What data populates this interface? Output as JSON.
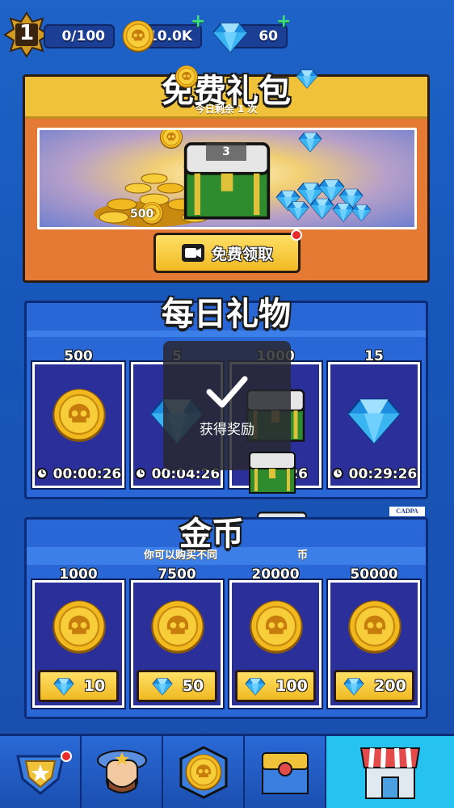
{
  "topbar": {
    "level": "1",
    "xp": "0/100",
    "coins": "10.0K",
    "gems": "60",
    "add_label": "+"
  },
  "free_gift": {
    "title": "免费礼包",
    "subtitle": "今日剩余 1 次",
    "chest_count": "3",
    "coin_amount": "500",
    "claim_label": "免费领取"
  },
  "daily_gifts": {
    "title": "每日礼物",
    "items": [
      {
        "amount": "500",
        "icon": "skull-coin-icon",
        "timer": "00:00:26"
      },
      {
        "amount": "5",
        "icon": "diamond-icon",
        "timer": "00:04:26"
      },
      {
        "amount": "1000",
        "icon": "chest-icon",
        "timer": "26"
      },
      {
        "amount": "15",
        "icon": "diamond-icon",
        "timer": "00:29:26"
      }
    ]
  },
  "toast": {
    "message": "获得奖励"
  },
  "coin_shop": {
    "title": "金币",
    "subtitle": "你可以购买不同",
    "subtitle_tail": "币",
    "items": [
      {
        "amount": "1000",
        "price": "10"
      },
      {
        "amount": "7500",
        "price": "50"
      },
      {
        "amount": "20000",
        "price": "100"
      },
      {
        "amount": "50000",
        "price": "200"
      }
    ]
  },
  "badge": "CADPA",
  "nav": {
    "items": [
      {
        "icon": "rank-shield-icon",
        "active": false
      },
      {
        "icon": "character-icon",
        "active": false
      },
      {
        "icon": "skull-emblem-icon",
        "active": false
      },
      {
        "icon": "treasure-chest-icon",
        "active": false
      },
      {
        "icon": "shop-icon",
        "active": true
      }
    ]
  },
  "colors": {
    "background": "#1e63c8",
    "gold": "#f0c23a",
    "orange_panel": "#e57a34",
    "card": "#2b2f9a",
    "gem": "#3bb4f2",
    "plus": "#3fe07a"
  }
}
